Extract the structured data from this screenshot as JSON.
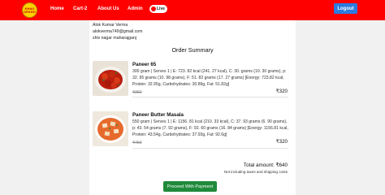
{
  "nav": {
    "logo_text": "KHAO\nDEKHO",
    "links": [
      "Home",
      "Cart-2",
      "About Us",
      "Admin"
    ],
    "live_label": "Live",
    "logout_label": "Logout"
  },
  "user": {
    "name": "Alok Kumar Verma",
    "email": "alokverma749@gmail.com",
    "address": "shiv nagar maharajganj"
  },
  "summary_title": "Order Summary",
  "items": [
    {
      "name": "Paneer 65",
      "description": "300 gram | Serves 1 | E: 723. 82 kcal (241. 27 kcal), C: 30. grams (10. 30 grams), p: 32. 95 grams (10. 98 grams), F: 51. 82 grams (17. 27 grams) [Energy: 723.82 kcal, Protein: 32.95g, Carbohydrates: 30.89g, Fat: 51.82g]",
      "mrp": "₹350",
      "price": "₹320"
    },
    {
      "name": "Paneer Butter Masala",
      "description": "550 gram | Serves 1 | E: 1156. 81 kcal (210. 33 kcal), C: 37. 93 grams (6. 90 grams), p: 43. 54 grams (7. 92 grams), F: 92. 60 grams (16. 84 grams) [Energy: 1156.81 kcal, Protein: 43.54g, Carbohydrates: 37.93g, Fat: 92.6g]",
      "mrp": "₹450",
      "price": "₹320"
    }
  ],
  "total": {
    "label": "Total amount: ₹640",
    "note": "Not including taxes and shipping costs"
  },
  "proceed_label": "Proceed With Payment",
  "colors": {
    "navbar": "#ff0000",
    "logout": "#2b7be0",
    "proceed": "#1e8a3a"
  }
}
